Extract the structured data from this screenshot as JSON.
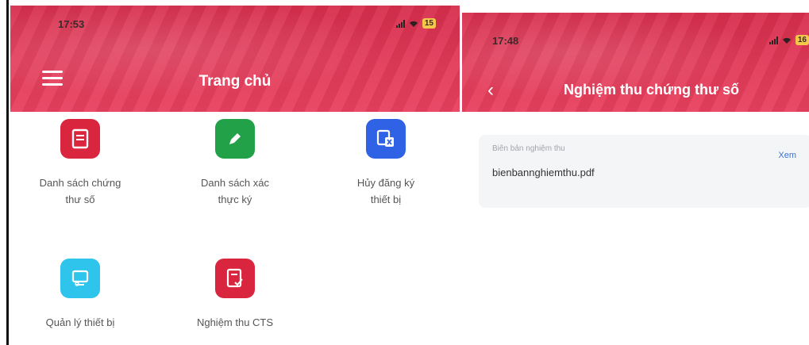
{
  "left_screen": {
    "status_time": "17:53",
    "battery": "15",
    "title": "Trang chủ",
    "tiles": [
      {
        "label_line1": "Danh sách chứng",
        "label_line2": "thư số",
        "color": "#d9253e",
        "icon": "document-icon"
      },
      {
        "label_line1": "Danh sách xác",
        "label_line2": "thực ký",
        "color": "#22a149",
        "icon": "pencil-icon"
      },
      {
        "label_line1": "Hủy đăng ký",
        "label_line2": "thiết bị",
        "color": "#2f62e4",
        "icon": "device-cancel-icon"
      },
      {
        "label_line1": "Quản lý thiết bị",
        "label_line2": "",
        "color": "#2ec4ec",
        "icon": "monitor-icon"
      },
      {
        "label_line1": "Nghiệm thu CTS",
        "label_line2": "",
        "color": "#d9253e",
        "icon": "document-check-icon"
      }
    ]
  },
  "right_screen": {
    "status_time": "17:48",
    "battery": "16",
    "title": "Nghiệm thu chứng thư số",
    "card": {
      "caption": "Biên bản nghiệm thu",
      "file_name": "bienbannghiemthu.pdf",
      "link_label": "Xem"
    }
  },
  "colors": {
    "header_red": "#e23a58",
    "link_blue": "#3b74d6"
  }
}
